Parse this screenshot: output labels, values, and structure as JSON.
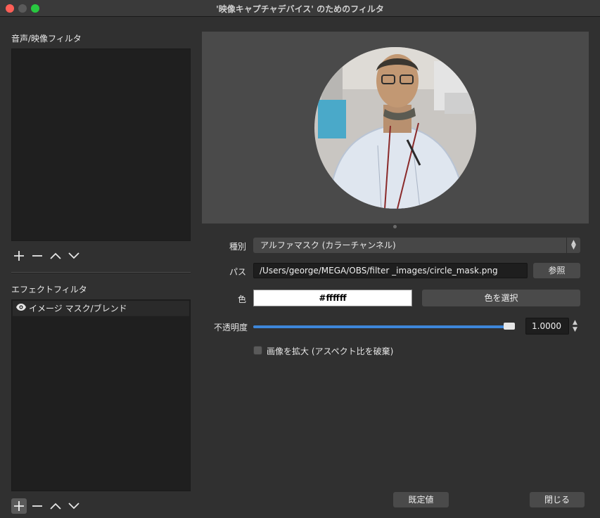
{
  "window": {
    "title": "'映像キャプチャデバイス' のためのフィルタ"
  },
  "left": {
    "audio_video_label": "音声/映像フィルタ",
    "effect_label": "エフェクトフィルタ",
    "effect_filters": [
      {
        "label": "イメージ マスク/ブレンド"
      }
    ],
    "toolbar_icons": [
      "plus-icon",
      "minus-icon",
      "up-icon",
      "down-icon"
    ]
  },
  "form": {
    "type_label": "種別",
    "type_value": "アルファマスク (カラーチャンネル)",
    "path_label": "パス",
    "path_value": "/Users/george/MEGA/OBS/filter _images/circle_mask.png",
    "browse_label": "参照",
    "color_label": "色",
    "color_value": "#ffffff",
    "select_color_label": "色を選択",
    "opacity_label": "不透明度",
    "opacity_value": "1.0000",
    "opacity_fraction": 1.0,
    "stretch_label": "画像を拡大 (アスペクト比を破棄)"
  },
  "footer": {
    "defaults_label": "既定値",
    "close_label": "閉じる"
  },
  "colors": {
    "accent": "#3d86d9",
    "background": "#303030",
    "panel": "#1f1f1f"
  }
}
